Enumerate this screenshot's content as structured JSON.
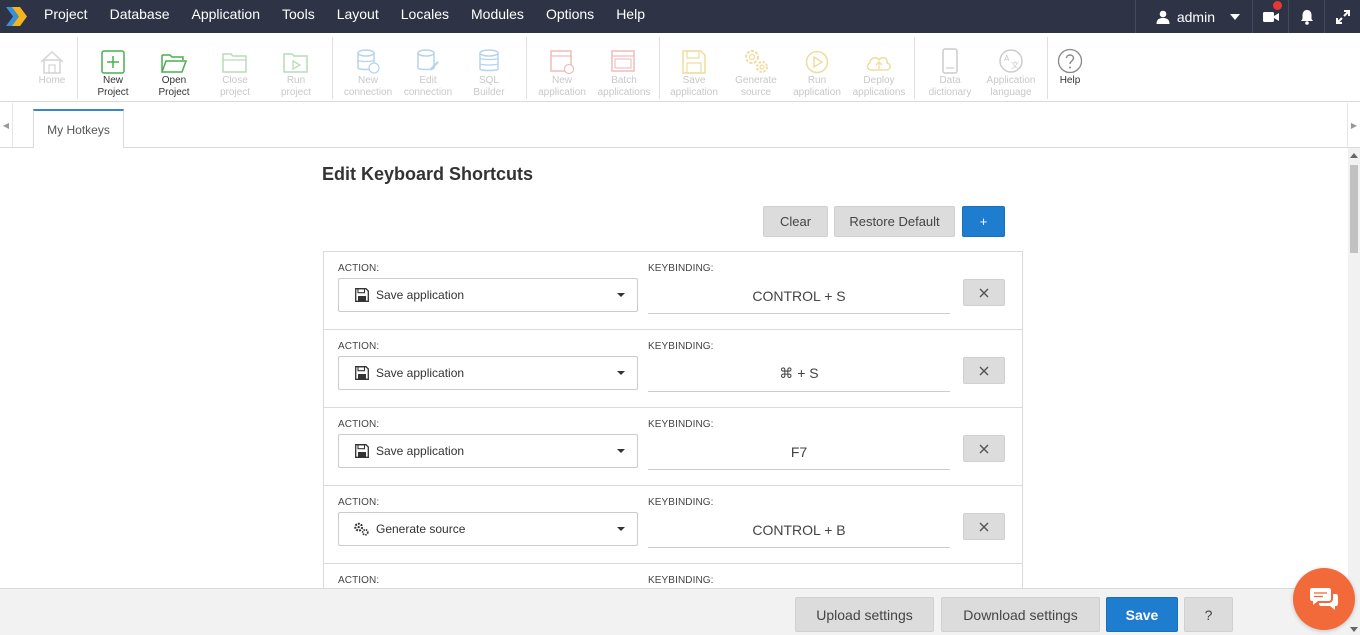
{
  "menubar": {
    "items": [
      "Project",
      "Database",
      "Application",
      "Tools",
      "Layout",
      "Locales",
      "Modules",
      "Options",
      "Help"
    ],
    "user": "admin"
  },
  "toolbar": {
    "home": "Home",
    "new_project": "New\nProject",
    "open_project": "Open\nProject",
    "close_project": "Close\nproject",
    "run_project": "Run\nproject",
    "new_connection": "New\nconnection",
    "edit_connection": "Edit\nconnection",
    "sql_builder": "SQL\nBuilder",
    "new_application": "New\napplication",
    "batch_applications": "Batch\napplications",
    "save_application": "Save\napplication",
    "generate_source": "Generate\nsource",
    "run_application": "Run\napplication",
    "deploy_applications": "Deploy\napplications",
    "data_dictionary": "Data\ndictionary",
    "application_language": "Application\nlanguage",
    "help": "Help"
  },
  "tabs": {
    "active": "My Hotkeys"
  },
  "page": {
    "title": "Edit Keyboard Shortcuts",
    "clear": "Clear",
    "restore_default": "Restore Default",
    "add": "+",
    "action_label": "ACTION:",
    "keybinding_label": "KEYBINDING:"
  },
  "shortcuts": [
    {
      "action": "Save application",
      "icon": "floppy-icon",
      "key": "CONTROL + S"
    },
    {
      "action": "Save application",
      "icon": "floppy-icon",
      "key": "⌘ + S"
    },
    {
      "action": "Save application",
      "icon": "floppy-icon",
      "key": "F7"
    },
    {
      "action": "Generate source",
      "icon": "gears-icon",
      "key": "CONTROL + B"
    }
  ],
  "footer": {
    "upload": "Upload settings",
    "download": "Download settings",
    "save": "Save",
    "help": "?"
  },
  "colors": {
    "menubar": "#2e3445",
    "accent": "#1f7dd0",
    "chat": "#f26a3a"
  }
}
